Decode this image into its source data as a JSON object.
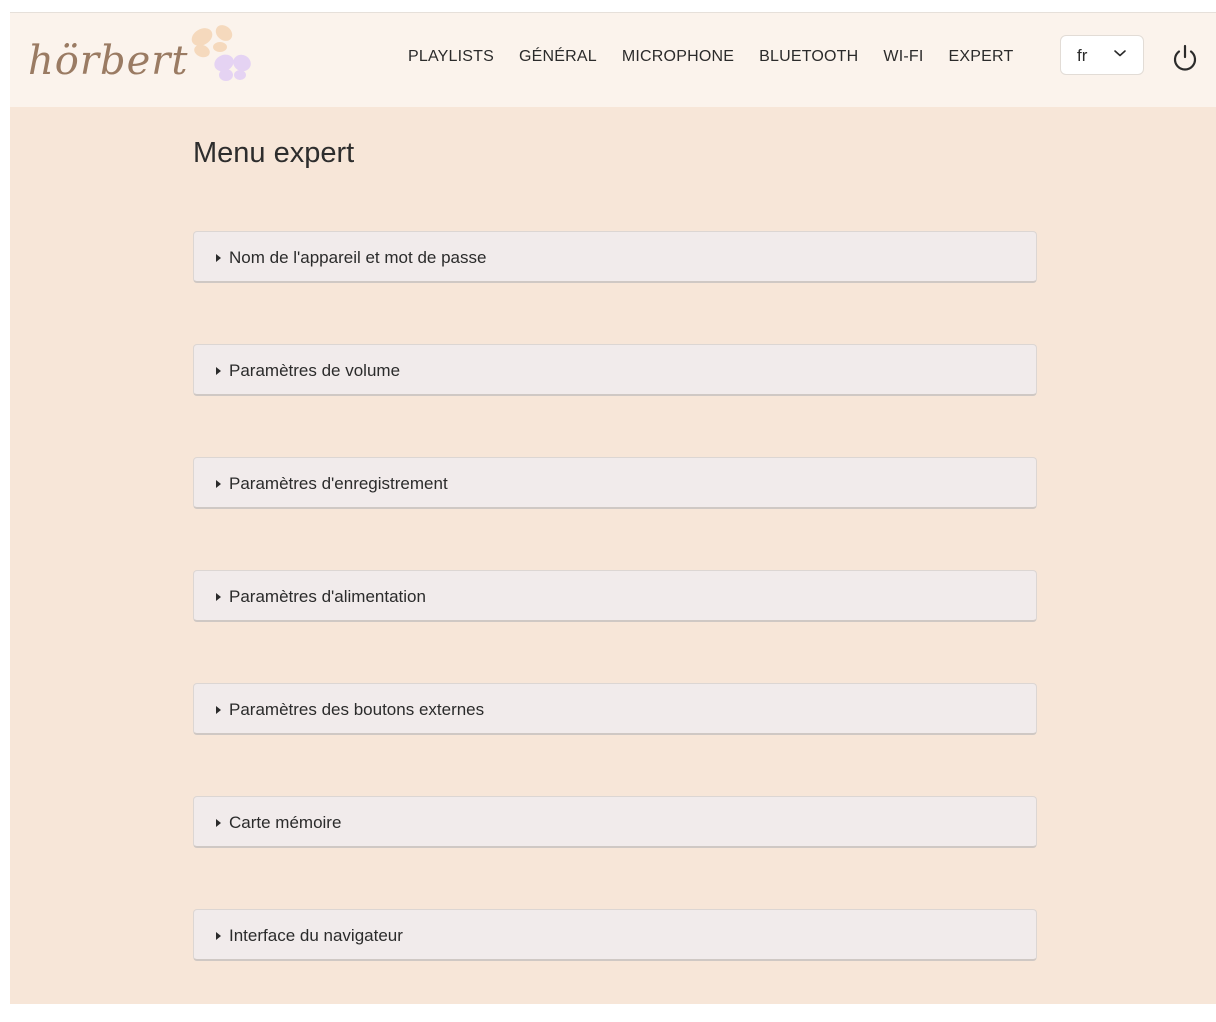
{
  "header": {
    "logo_text": "hörbert",
    "nav": [
      "PLAYLISTS",
      "GÉNÉRAL",
      "MICROPHONE",
      "BLUETOOTH",
      "WI-FI",
      "EXPERT"
    ],
    "language": "fr",
    "icons": {
      "logo": "butterfly-icon",
      "language_dropdown": "chevron-down-icon",
      "power": "power-icon"
    }
  },
  "main": {
    "title": "Menu expert",
    "sections": [
      {
        "label": "Nom de l'appareil et mot de passe"
      },
      {
        "label": "Paramètres de volume"
      },
      {
        "label": "Paramètres d'enregistrement"
      },
      {
        "label": "Paramètres d'alimentation"
      },
      {
        "label": "Paramètres des boutons externes"
      },
      {
        "label": "Carte mémoire"
      },
      {
        "label": "Interface du navigateur"
      }
    ]
  },
  "colors": {
    "page_background": "#f7e6d8",
    "header_background": "#fbf3ec",
    "panel_background": "#f1ebeb",
    "logo": "#9a7b63"
  }
}
